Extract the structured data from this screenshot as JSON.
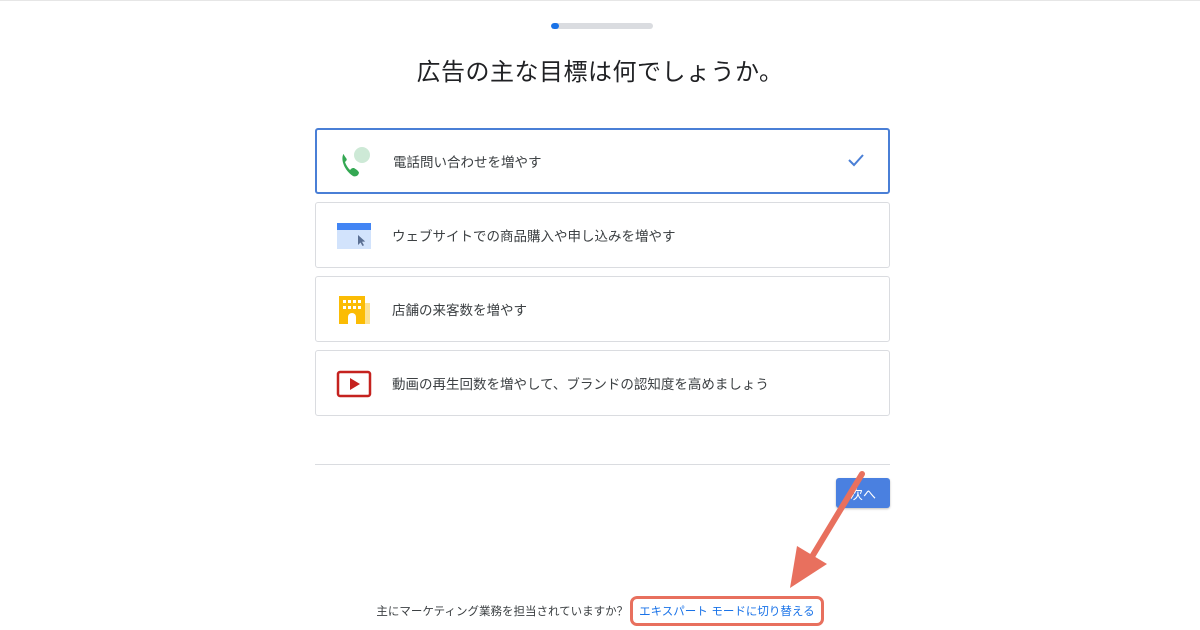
{
  "progress": {
    "value": 0.08,
    "color": "#1a73e8"
  },
  "title": "広告の主な目標は何でしょうか。",
  "options": [
    {
      "label": "電話問い合わせを増やす",
      "icon": "phone-icon",
      "selected": true
    },
    {
      "label": "ウェブサイトでの商品購入や申し込みを増やす",
      "icon": "website-icon",
      "selected": false
    },
    {
      "label": "店舗の来客数を増やす",
      "icon": "store-icon",
      "selected": false
    },
    {
      "label": "動画の再生回数を増やして、ブランドの認知度を高めましょう",
      "icon": "video-play-icon",
      "selected": false
    }
  ],
  "next_button": {
    "label": "次へ"
  },
  "footer": {
    "question": "主にマーケティング業務を担当されていますか？",
    "link": "エキスパート モードに切り替える"
  },
  "colors": {
    "accent": "#1a73e8",
    "annotation": "#e8705e",
    "selected_border": "#4a7fd6"
  }
}
